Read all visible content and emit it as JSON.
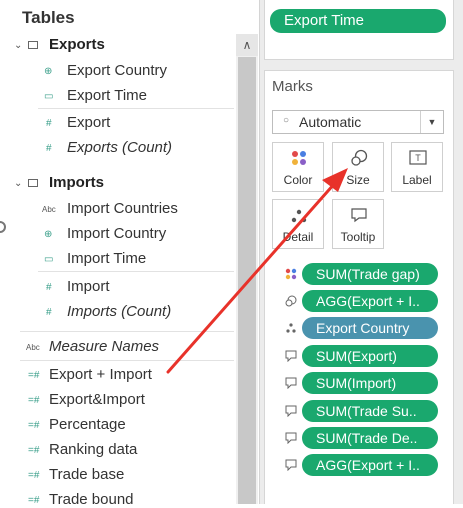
{
  "tables_panel": {
    "title": "Tables",
    "groups": [
      {
        "name": "Exports",
        "fields": [
          "Export Country",
          "Export Time",
          "Export",
          "Exports (Count)"
        ]
      },
      {
        "name": "Imports",
        "fields": [
          "Import Countries",
          "Import Country",
          "Import Time",
          "Import",
          "Imports (Count)"
        ]
      }
    ],
    "measure_names": "Measure Names",
    "measures": [
      "Export + Import",
      "Export&Import",
      "Percentage",
      "Ranking data",
      "Trade base",
      "Trade bound"
    ],
    "abc_tag": "Abc"
  },
  "filters": {
    "export_time": "Export Time"
  },
  "marks": {
    "title": "Marks",
    "type_selected": "Automatic",
    "buttons": {
      "color": "Color",
      "size": "Size",
      "label": "Label",
      "detail": "Detail",
      "tooltip": "Tooltip"
    },
    "pills": [
      "SUM(Trade gap)",
      "AGG(Export + I..",
      "Export Country",
      "SUM(Export)",
      "SUM(Import)",
      "SUM(Trade Su..",
      "SUM(Trade De..",
      "AGG(Export + I.."
    ]
  },
  "colors": {
    "accent": "#1aa86e",
    "dimension": "#4a93ae",
    "arrow": "#e8322a"
  }
}
